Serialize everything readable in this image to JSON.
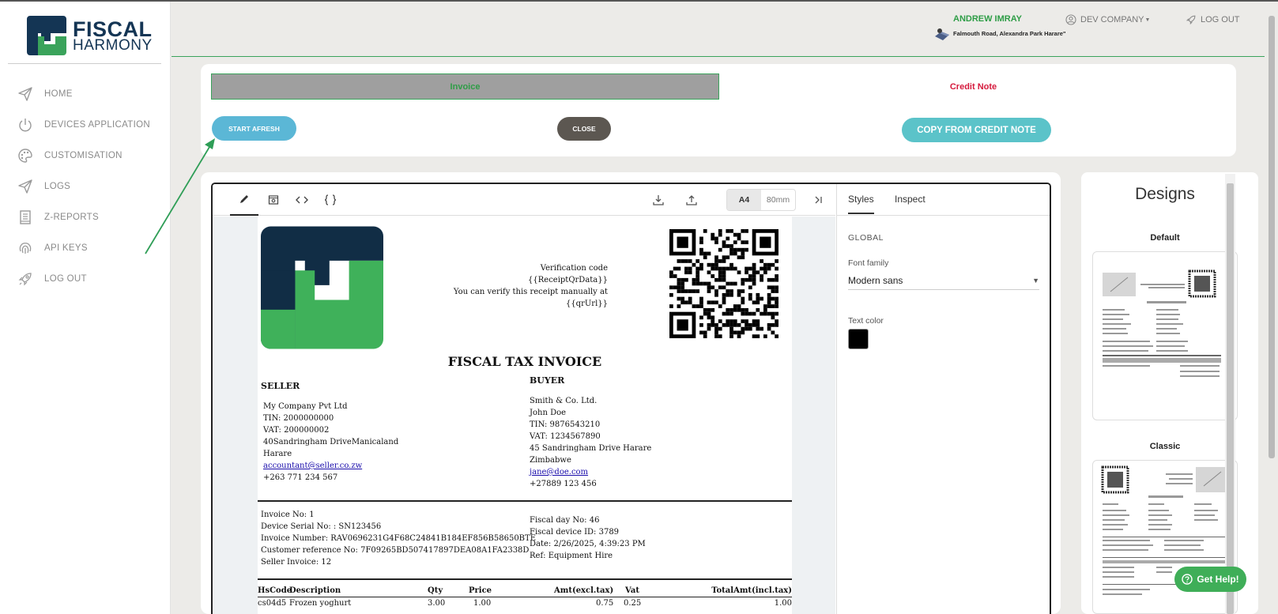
{
  "brand": {
    "line1": "FISCAL",
    "line2": "HARMONY"
  },
  "sidebar": {
    "items": [
      {
        "label": "HOME",
        "icon": "paper-plane-icon"
      },
      {
        "label": "DEVICES APPLICATION",
        "icon": "power-icon"
      },
      {
        "label": "CUSTOMISATION",
        "icon": "palette-icon"
      },
      {
        "label": "LOGS",
        "icon": "paper-plane-icon"
      },
      {
        "label": "Z-REPORTS",
        "icon": "report-icon"
      },
      {
        "label": "API KEYS",
        "icon": "fingerprint-icon"
      },
      {
        "label": "LOG OUT",
        "icon": "rocket-icon"
      }
    ]
  },
  "header": {
    "user_name": "ANDREW IMRAY",
    "user_address": "Falmouth Road, Alexandra Park Harare\"",
    "company": "DEV COMPANY",
    "logout": "LOG OUT"
  },
  "tabs": {
    "invoice": "Invoice",
    "credit_note": "Credit Note"
  },
  "actions": {
    "start_afresh": "START AFRESH",
    "close": "CLOSE",
    "copy_from_credit_note": "COPY FROM CREDIT NOTE"
  },
  "editor": {
    "sizes": {
      "a4": "A4",
      "mm80": "80mm",
      "selected": "A4"
    },
    "side_tabs": {
      "styles": "Styles",
      "inspect": "Inspect"
    },
    "global_label": "GLOBAL",
    "font_family_label": "Font family",
    "font_family_value": "Modern sans",
    "text_color_label": "Text color",
    "text_color_value": "#000000"
  },
  "invoice": {
    "verify": {
      "line1": "Verification code",
      "line2": "{{ReceiptQrData}}",
      "line3": "You can verify this receipt manually at",
      "line4": "{{qrUrl}}"
    },
    "title": "FISCAL TAX INVOICE",
    "seller": {
      "heading": "SELLER",
      "name": "My Company Pvt Ltd",
      "tin": "TIN: 2000000000",
      "vat": "VAT: 200000002",
      "address": "40Sandringham DriveManicaland",
      "city": "Harare",
      "email": "accountant@seller.co.zw",
      "phone": "+263 771 234 567"
    },
    "buyer": {
      "heading": "BUYER",
      "name": "Smith & Co. Ltd.",
      "contact": "John Doe",
      "tin": "TIN: 9876543210",
      "vat": "VAT: 1234567890",
      "address": "45 Sandringham Drive Harare",
      "country": "Zimbabwe",
      "email": "jane@doe.com",
      "phone": "+27889 123 456"
    },
    "meta_left": {
      "invoice_no": "Invoice No: 1",
      "device_serial": "Device Serial No: : SN123456",
      "invoice_number": "Invoice Number: RAV0696231G4F68C24841B184EF856B58650BTE",
      "customer_ref": "Customer reference No: 7F09265BD507417897DEA08A1FA2338D",
      "seller_invoice": "Seller Invoice: 12"
    },
    "meta_right": {
      "fiscal_day": "Fiscal day No: 46",
      "device_id": "Fiscal device ID: 3789",
      "date": "Date: 2/26/2025, 4:39:23 PM",
      "ref": "Ref: Equipment Hire"
    },
    "table": {
      "headers": [
        "HsCode",
        "Description",
        "Qty",
        "Price",
        "Amt(excl.tax)",
        "Vat",
        "TotalAmt(incl.tax)"
      ],
      "rows": [
        [
          "cs04d5",
          "Frozen yoghurt",
          "3.00",
          "1.00",
          "0.75",
          "0.25",
          "1.00"
        ]
      ]
    }
  },
  "designs": {
    "title": "Designs",
    "items": [
      {
        "name": "Default"
      },
      {
        "name": "Classic"
      }
    ]
  },
  "help": {
    "label": "Get Help!"
  },
  "colors": {
    "brand_green": "#3aa35b",
    "brand_navy": "#143554",
    "credit_red": "#d51a3d",
    "start_blue": "#5bb7d6",
    "copy_teal": "#5bc3c9"
  }
}
